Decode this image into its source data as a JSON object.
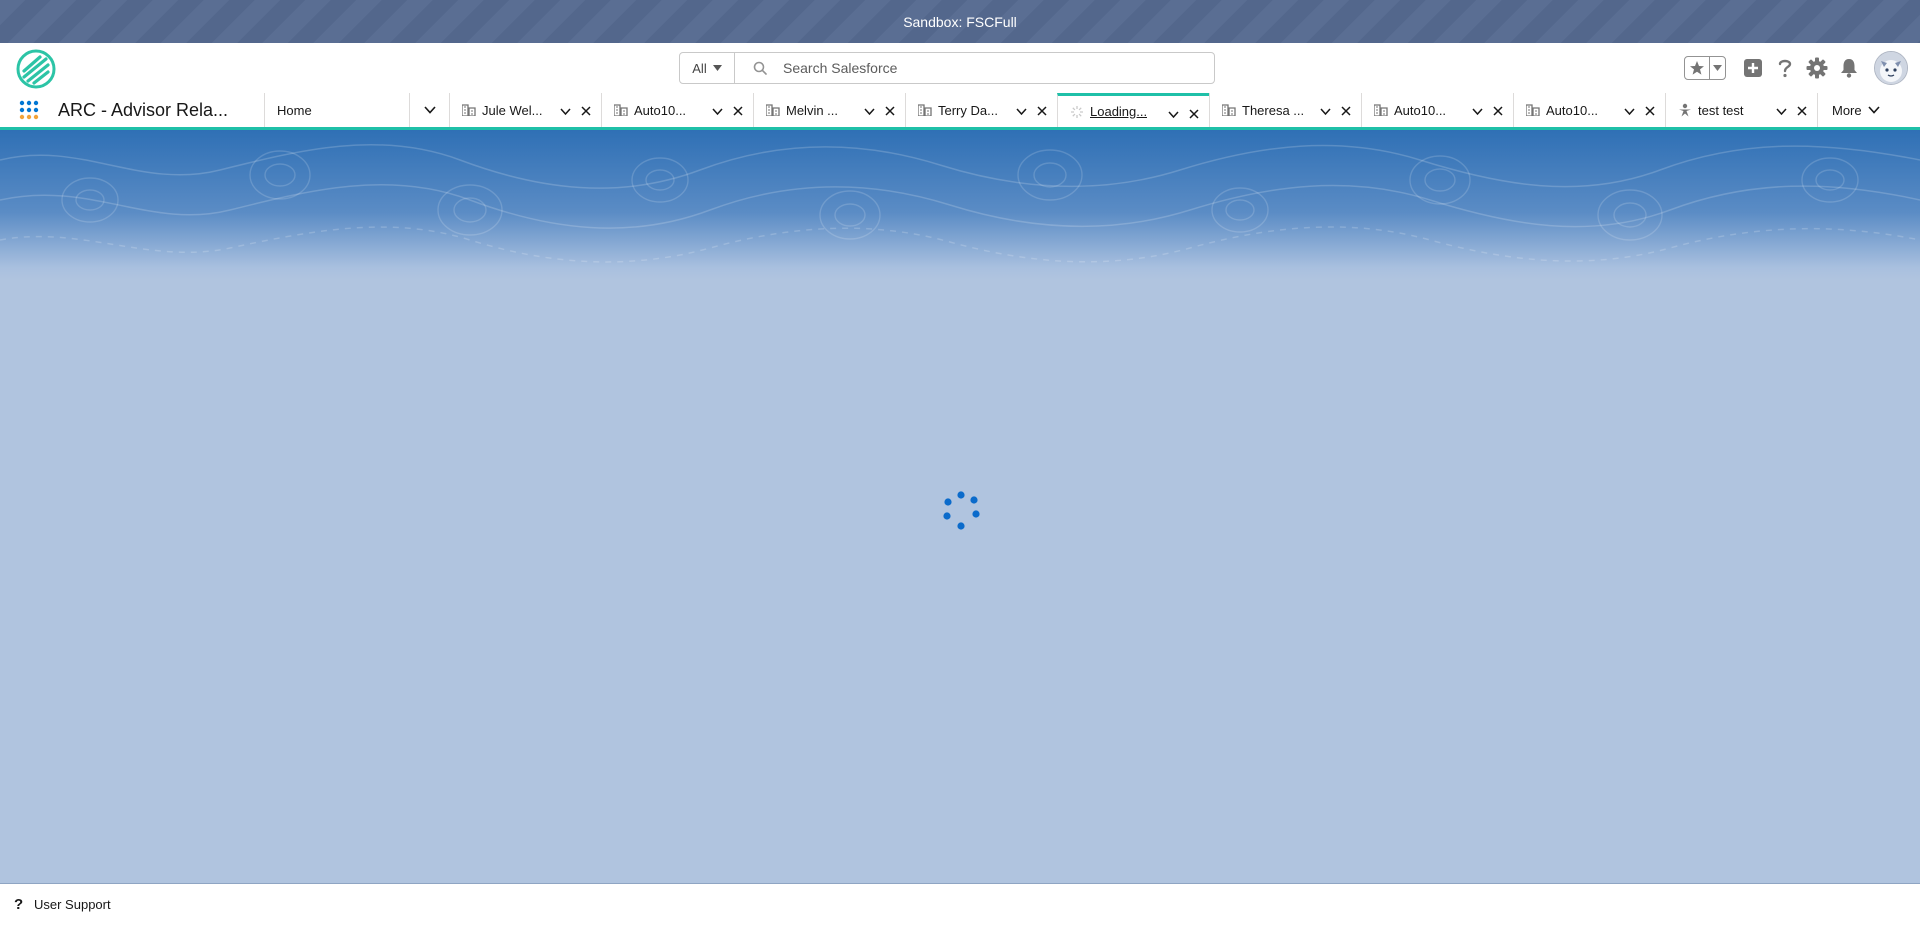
{
  "sandbox": {
    "label": "Sandbox: FSCFull"
  },
  "colors": {
    "brand": "#1fc0a8",
    "spinner": "#0b6bcb",
    "banner": "#2f70b5",
    "background": "#b0c4df"
  },
  "header": {
    "search": {
      "scope": "All",
      "placeholder": "Search Salesforce"
    },
    "icons": [
      "favorites-star-icon",
      "global-actions-plus-icon",
      "help-icon",
      "setup-gear-icon",
      "notifications-bell-icon",
      "user-avatar"
    ]
  },
  "nav": {
    "app_name": "ARC - Advisor Rela...",
    "home_label": "Home",
    "tabs": [
      {
        "label": "Jule Wel...",
        "icon": "account-icon"
      },
      {
        "label": "Auto10...",
        "icon": "account-icon"
      },
      {
        "label": "Melvin ...",
        "icon": "account-icon"
      },
      {
        "label": "Terry Da...",
        "icon": "account-icon"
      },
      {
        "label": "Loading...",
        "icon": "loading-icon",
        "active": true
      },
      {
        "label": "Theresa ...",
        "icon": "account-icon"
      },
      {
        "label": "Auto10...",
        "icon": "account-icon"
      },
      {
        "label": "Auto10...",
        "icon": "account-icon"
      },
      {
        "label": "test test",
        "icon": "person-account-icon"
      }
    ],
    "more_label": "More"
  },
  "footer": {
    "label": "User Support"
  }
}
